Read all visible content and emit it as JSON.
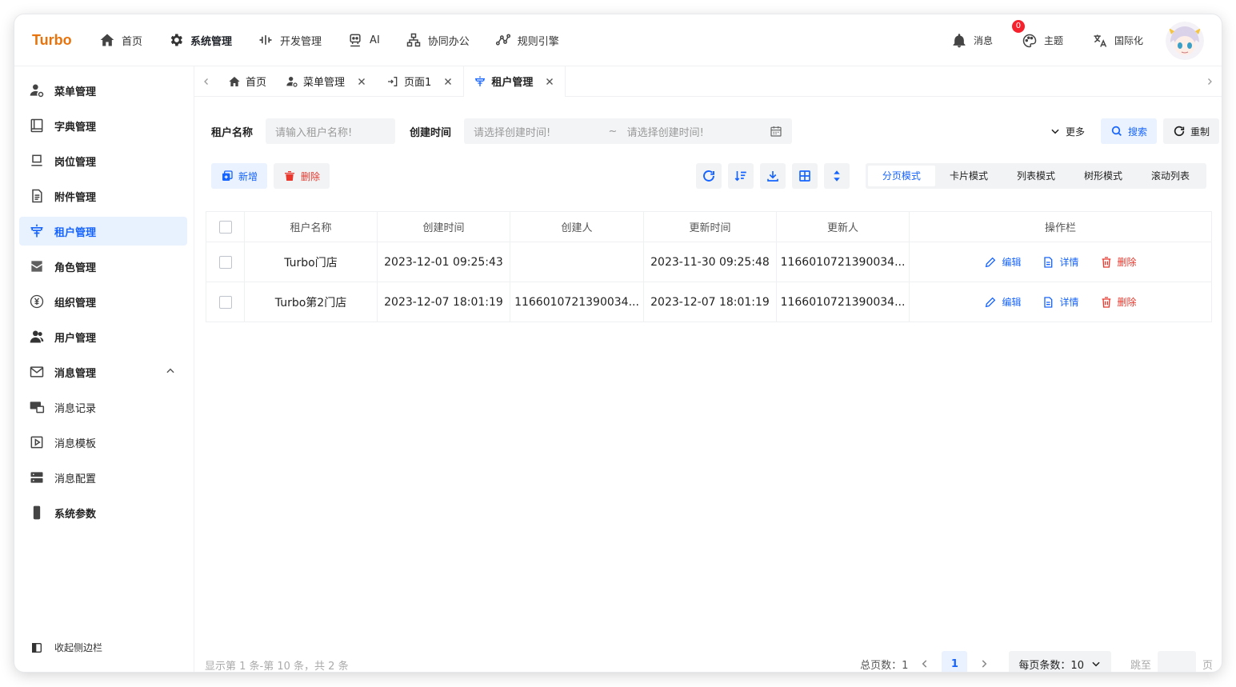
{
  "app": {
    "brand": "Turbo"
  },
  "topnav": [
    {
      "label": "首页",
      "icon": "home-icon"
    },
    {
      "label": "系统管理",
      "icon": "gear-icon",
      "active": true
    },
    {
      "label": "开发管理",
      "icon": "dev-icon"
    },
    {
      "label": "AI",
      "icon": "robot-icon"
    },
    {
      "label": "协同办公",
      "icon": "org-icon"
    },
    {
      "label": "规则引擎",
      "icon": "graph-icon"
    }
  ],
  "topright": {
    "messages": {
      "label": "消息",
      "badge": "0"
    },
    "theme": {
      "label": "主题"
    },
    "i18n": {
      "label": "国际化"
    }
  },
  "sidebar": {
    "items": [
      {
        "label": "菜单管理"
      },
      {
        "label": "字典管理"
      },
      {
        "label": "岗位管理"
      },
      {
        "label": "附件管理"
      },
      {
        "label": "租户管理",
        "active": true
      },
      {
        "label": "角色管理"
      },
      {
        "label": "组织管理"
      },
      {
        "label": "用户管理"
      },
      {
        "label": "消息管理",
        "expanded": true
      },
      {
        "label": "消息记录"
      },
      {
        "label": "消息模板"
      },
      {
        "label": "消息配置"
      },
      {
        "label": "系统参数"
      }
    ],
    "collapse_label": "收起侧边栏"
  },
  "tabs": [
    {
      "label": "首页",
      "closable": false
    },
    {
      "label": "菜单管理",
      "closable": true
    },
    {
      "label": "页面1",
      "closable": true
    },
    {
      "label": "租户管理",
      "closable": true,
      "active": true
    }
  ],
  "filters": {
    "tenant_name_label": "租户名称",
    "tenant_name_placeholder": "请输入租户名称!",
    "created_label": "创建时间",
    "created_start_placeholder": "请选择创建时间!",
    "range_sep": "~",
    "created_end_placeholder": "请选择创建时间!",
    "more_label": "更多",
    "search_label": "搜索",
    "reset_label": "重制"
  },
  "toolbar": {
    "add_label": "新增",
    "delete_label": "删除",
    "modes": [
      "分页模式",
      "卡片模式",
      "列表模式",
      "树形模式",
      "滚动列表"
    ],
    "active_mode": "分页模式"
  },
  "table": {
    "columns": [
      "租户名称",
      "创建时间",
      "创建人",
      "更新时间",
      "更新人",
      "操作栏"
    ],
    "rows": [
      [
        "Turbo门店",
        "2023-12-01 09:25:43",
        "",
        "2023-11-30 09:25:48",
        "1166010721390034..."
      ],
      [
        "Turbo第2门店",
        "2023-12-07 18:01:19",
        "1166010721390034...",
        "2023-12-07 18:01:19",
        "1166010721390034..."
      ]
    ],
    "actions": {
      "edit": "编辑",
      "detail": "详情",
      "delete": "删除"
    }
  },
  "footer": {
    "info": "显示第 1 条-第 10 条，共 2 条",
    "total_pages": "总页数：1",
    "current_page": "1",
    "page_size": "每页条数：10",
    "jump_to": "跳至",
    "page_unit": "页"
  },
  "colors": {
    "brand": "#e8730c",
    "accent": "#1664ff",
    "danger": "#e8372c"
  }
}
